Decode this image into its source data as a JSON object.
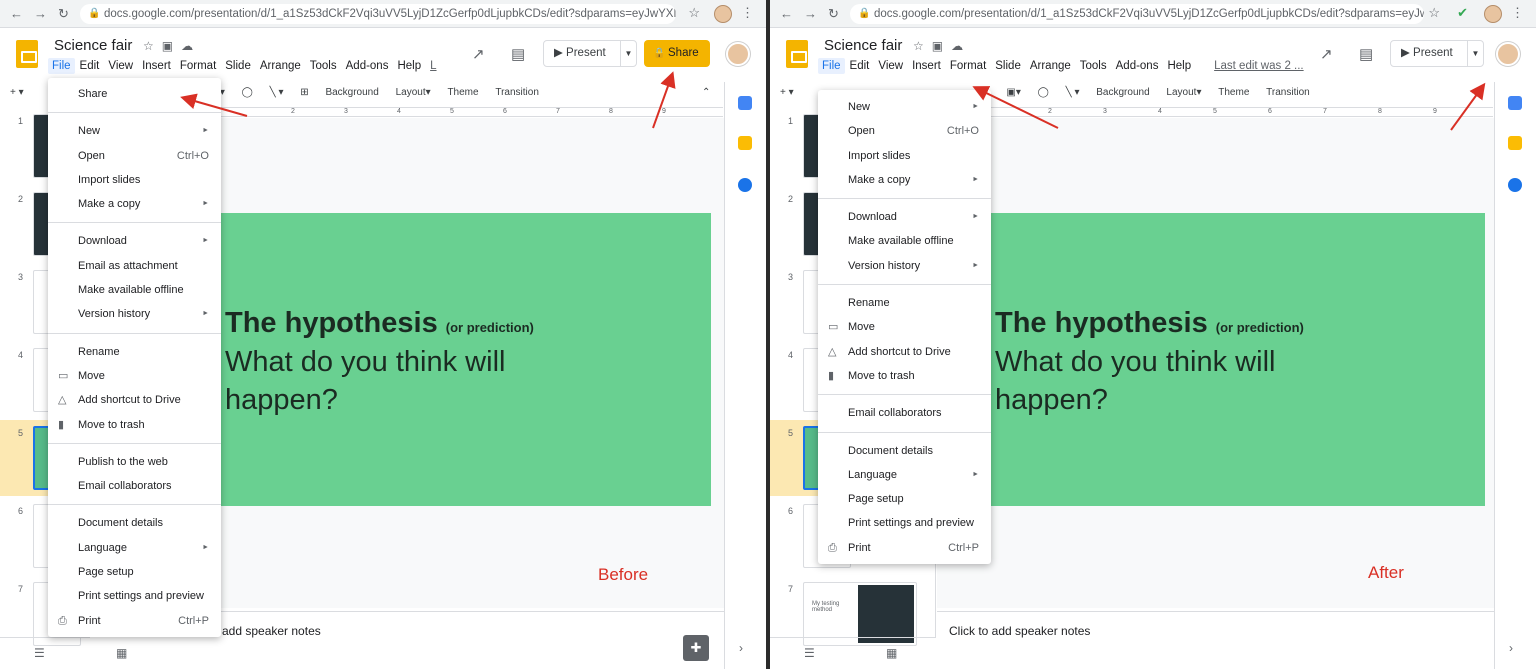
{
  "browser": {
    "url": "docs.google.com/presentation/d/1_a1Sz53dCkF2Vqi3uVV5LyjD1ZcGerfp0dLjupbkCDs/edit?sdparams=eyJwYXNzc2FmZW...",
    "url_after": "docs.google.com/presentation/d/1_a1Sz53dCkF2Vqi3uVV5LyjD1ZcGerfp0dLjupbkCDs/edit?sdparams=eyJwYXNzc2..."
  },
  "doc": {
    "title": "Science fair"
  },
  "menus": [
    "File",
    "Edit",
    "View",
    "Insert",
    "Format",
    "Slide",
    "Arrange",
    "Tools",
    "Add-ons",
    "Help"
  ],
  "menu_truncated": "L",
  "last_edit": "Last edit was 2 ...",
  "buttons": {
    "present": "Present",
    "share": "Share"
  },
  "toolbar": {
    "background": "Background",
    "layout": "Layout",
    "theme": "Theme",
    "transition": "Transition"
  },
  "ruler_ticks": [
    "1",
    "2",
    "3",
    "4",
    "5",
    "6",
    "7",
    "8",
    "9"
  ],
  "slides": [
    {
      "num": "1"
    },
    {
      "num": "2"
    },
    {
      "num": "3"
    },
    {
      "num": "4"
    },
    {
      "num": "5"
    },
    {
      "num": "6"
    },
    {
      "num": "7"
    }
  ],
  "slide7_thumb": {
    "left": "My testing method",
    "right": ""
  },
  "slide": {
    "title": "The hypothesis",
    "subtitle": "(or prediction)",
    "body_line1": "What do you think will",
    "body_line2": "happen?"
  },
  "labels": {
    "before": "Before",
    "after": "After"
  },
  "notes": {
    "before": "add speaker notes",
    "after": "Click to add speaker notes"
  },
  "menu_before": [
    {
      "label": "Share"
    },
    {
      "sep": true
    },
    {
      "label": "New",
      "arrow": true
    },
    {
      "label": "Open",
      "shortcut": "Ctrl+O"
    },
    {
      "label": "Import slides"
    },
    {
      "label": "Make a copy",
      "arrow": true
    },
    {
      "sep": true
    },
    {
      "label": "Download",
      "arrow": true
    },
    {
      "label": "Email as attachment"
    },
    {
      "label": "Make available offline"
    },
    {
      "label": "Version history",
      "arrow": true
    },
    {
      "sep": true
    },
    {
      "label": "Rename"
    },
    {
      "label": "Move",
      "icon": "folder-icon"
    },
    {
      "label": "Add shortcut to Drive",
      "icon": "drive-icon"
    },
    {
      "label": "Move to trash",
      "icon": "trash-icon"
    },
    {
      "sep": true
    },
    {
      "label": "Publish to the web"
    },
    {
      "label": "Email collaborators"
    },
    {
      "sep": true
    },
    {
      "label": "Document details"
    },
    {
      "label": "Language",
      "arrow": true
    },
    {
      "label": "Page setup"
    },
    {
      "label": "Print settings and preview"
    },
    {
      "label": "Print",
      "shortcut": "Ctrl+P",
      "icon": "print-icon"
    }
  ],
  "menu_after": [
    {
      "label": "New",
      "arrow": true
    },
    {
      "label": "Open",
      "shortcut": "Ctrl+O"
    },
    {
      "label": "Import slides"
    },
    {
      "label": "Make a copy",
      "arrow": true
    },
    {
      "sep": true
    },
    {
      "label": "Download",
      "arrow": true
    },
    {
      "label": "Make available offline"
    },
    {
      "label": "Version history",
      "arrow": true
    },
    {
      "sep": true
    },
    {
      "label": "Rename"
    },
    {
      "label": "Move",
      "icon": "folder-icon"
    },
    {
      "label": "Add shortcut to Drive",
      "icon": "drive-icon"
    },
    {
      "label": "Move to trash",
      "icon": "trash-icon"
    },
    {
      "sep": true
    },
    {
      "label": "Email collaborators"
    },
    {
      "sep": true
    },
    {
      "label": "Document details"
    },
    {
      "label": "Language",
      "arrow": true
    },
    {
      "label": "Page setup"
    },
    {
      "label": "Print settings and preview"
    },
    {
      "label": "Print",
      "shortcut": "Ctrl+P",
      "icon": "print-icon"
    }
  ],
  "colors": {
    "share_yellow": "#f4b400",
    "slide_green": "#69d091",
    "arrow_red": "#d93025",
    "selected_slide": "#fce8b2"
  }
}
